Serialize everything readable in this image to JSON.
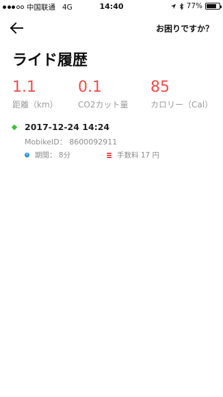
{
  "status_bar": {
    "carrier": "中国联通",
    "network": "4G",
    "time": "14:40",
    "battery": "77%",
    "battery_level": 0.77,
    "icons": [
      "location-arrow-icon",
      "bluetooth-icon",
      "battery-icon"
    ]
  },
  "nav": {
    "back_icon": "arrow-left-icon",
    "help_label": "お困りですか？"
  },
  "page": {
    "title": "ライド履歴"
  },
  "stats": [
    {
      "value": "1.1",
      "label": "距離（km）"
    },
    {
      "value": "0.1",
      "label": "CO2カット量"
    },
    {
      "value": "85",
      "label": "カロリー（Cal）"
    }
  ],
  "rides": [
    {
      "datetime": "2017-12-24 14:24",
      "mobike_id": "MobikeID： 8600092911",
      "duration": "期間： 8分",
      "fee": "手数料 17 円"
    }
  ],
  "colors": {
    "accent_red": "#f04a4a",
    "marker_green": "#3cc33c",
    "clock_blue": "#2a8fe0"
  }
}
